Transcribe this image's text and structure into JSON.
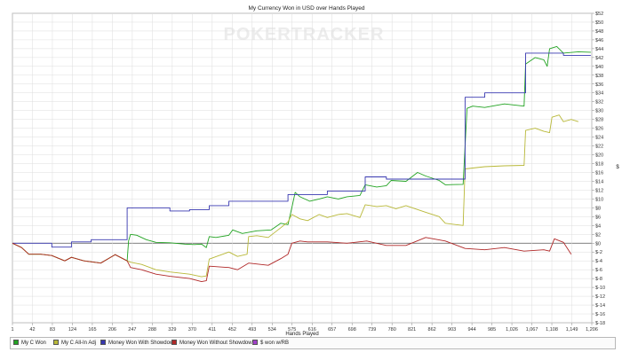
{
  "chart_data": {
    "type": "line",
    "title": "My Currency Won in USD over Hands Played",
    "watermark": "POKERTRACKER",
    "xlabel": "Hands Played",
    "ylabel": "$",
    "xlim": [
      1,
      1208
    ],
    "ylim": [
      -18,
      52
    ],
    "x_tick_labels": [
      "1",
      "42",
      "83",
      "124",
      "165",
      "206",
      "247",
      "288",
      "329",
      "370",
      "411",
      "452",
      "493",
      "534",
      "575",
      "616",
      "657",
      "698",
      "739",
      "780",
      "821",
      "862",
      "903",
      "944",
      "985",
      "1,026",
      "1,067",
      "1,108",
      "1,149",
      "1,206"
    ],
    "y_ticks": [
      -18,
      -16,
      -14,
      -12,
      -10,
      -8,
      -6,
      -4,
      -2,
      0,
      2,
      4,
      6,
      8,
      10,
      12,
      14,
      16,
      18,
      20,
      22,
      24,
      26,
      28,
      30,
      32,
      34,
      36,
      38,
      40,
      42,
      44,
      46,
      48,
      50,
      52
    ],
    "grid": true,
    "legend_position": "bottom",
    "series": [
      {
        "name": "My C Won",
        "color": "#22a322",
        "points": [
          [
            1,
            0
          ],
          [
            20,
            -1
          ],
          [
            35,
            -2.5
          ],
          [
            60,
            -2.5
          ],
          [
            83,
            -2.8
          ],
          [
            110,
            -4
          ],
          [
            124,
            -3.2
          ],
          [
            150,
            -4
          ],
          [
            185,
            -4.5
          ],
          [
            215,
            -2.6
          ],
          [
            240,
            -4
          ],
          [
            243,
            0.5
          ],
          [
            247,
            2
          ],
          [
            260,
            1.8
          ],
          [
            280,
            0.8
          ],
          [
            300,
            0.2
          ],
          [
            329,
            0.1
          ],
          [
            360,
            -0.2
          ],
          [
            380,
            -0.3
          ],
          [
            395,
            -0.2
          ],
          [
            405,
            -1
          ],
          [
            411,
            1.5
          ],
          [
            425,
            1.3
          ],
          [
            452,
            1.8
          ],
          [
            460,
            3
          ],
          [
            480,
            2.2
          ],
          [
            510,
            2.8
          ],
          [
            540,
            3
          ],
          [
            560,
            4.5
          ],
          [
            575,
            4.2
          ],
          [
            583,
            8
          ],
          [
            590,
            11.5
          ],
          [
            600,
            10.5
          ],
          [
            620,
            9.5
          ],
          [
            640,
            10
          ],
          [
            657,
            10.5
          ],
          [
            680,
            10
          ],
          [
            698,
            10.5
          ],
          [
            725,
            10.8
          ],
          [
            736,
            13.2
          ],
          [
            760,
            12.7
          ],
          [
            780,
            13
          ],
          [
            790,
            14.2
          ],
          [
            821,
            14
          ],
          [
            845,
            16
          ],
          [
            862,
            15.2
          ],
          [
            890,
            14.2
          ],
          [
            903,
            13.2
          ],
          [
            940,
            13.3
          ],
          [
            944,
            22
          ],
          [
            948,
            30.5
          ],
          [
            960,
            31
          ],
          [
            985,
            30.7
          ],
          [
            1026,
            31.5
          ],
          [
            1067,
            31
          ],
          [
            1070,
            40.5
          ],
          [
            1090,
            42
          ],
          [
            1108,
            41.5
          ],
          [
            1115,
            40
          ],
          [
            1120,
            44
          ],
          [
            1135,
            44.5
          ],
          [
            1149,
            43
          ],
          [
            1180,
            43.3
          ],
          [
            1206,
            43.2
          ]
        ]
      },
      {
        "name": "My C All-In Adj",
        "color": "#b8b838",
        "points": [
          [
            1,
            0
          ],
          [
            20,
            -1
          ],
          [
            35,
            -2.5
          ],
          [
            60,
            -2.5
          ],
          [
            83,
            -2.8
          ],
          [
            110,
            -4
          ],
          [
            124,
            -3.2
          ],
          [
            150,
            -4
          ],
          [
            185,
            -4.5
          ],
          [
            215,
            -2.6
          ],
          [
            240,
            -4
          ],
          [
            247,
            -4.3
          ],
          [
            270,
            -4.8
          ],
          [
            300,
            -6
          ],
          [
            329,
            -6.5
          ],
          [
            370,
            -7
          ],
          [
            395,
            -7.6
          ],
          [
            405,
            -7.4
          ],
          [
            411,
            -3.6
          ],
          [
            452,
            -2
          ],
          [
            470,
            -3
          ],
          [
            490,
            -2.5
          ],
          [
            493,
            1.5
          ],
          [
            510,
            1.7
          ],
          [
            534,
            1.3
          ],
          [
            560,
            3.5
          ],
          [
            575,
            4.8
          ],
          [
            583,
            6.5
          ],
          [
            600,
            5.5
          ],
          [
            616,
            5.1
          ],
          [
            640,
            6.5
          ],
          [
            657,
            5.8
          ],
          [
            680,
            6.5
          ],
          [
            698,
            6.7
          ],
          [
            725,
            5.8
          ],
          [
            736,
            8.7
          ],
          [
            760,
            8.3
          ],
          [
            780,
            8.5
          ],
          [
            800,
            7.8
          ],
          [
            821,
            8.5
          ],
          [
            862,
            7
          ],
          [
            890,
            6
          ],
          [
            903,
            4.5
          ],
          [
            940,
            4
          ],
          [
            944,
            16.8
          ],
          [
            960,
            17
          ],
          [
            985,
            17.3
          ],
          [
            1026,
            17.5
          ],
          [
            1067,
            17.6
          ],
          [
            1070,
            25.5
          ],
          [
            1090,
            26
          ],
          [
            1108,
            25.3
          ],
          [
            1120,
            25
          ],
          [
            1125,
            28.5
          ],
          [
            1140,
            29
          ],
          [
            1149,
            27.5
          ],
          [
            1165,
            28
          ],
          [
            1180,
            27.5
          ]
        ]
      },
      {
        "name": "Money Won With Showdown",
        "color": "#3838b0",
        "points": [
          [
            1,
            0
          ],
          [
            83,
            0
          ],
          [
            83,
            -0.9
          ],
          [
            124,
            -0.9
          ],
          [
            124,
            0.3
          ],
          [
            165,
            0.3
          ],
          [
            165,
            0.8
          ],
          [
            240,
            0.8
          ],
          [
            240,
            8
          ],
          [
            329,
            8
          ],
          [
            329,
            7.3
          ],
          [
            370,
            7.3
          ],
          [
            370,
            7.6
          ],
          [
            411,
            7.6
          ],
          [
            411,
            8.5
          ],
          [
            452,
            8.5
          ],
          [
            452,
            9.5
          ],
          [
            575,
            9.5
          ],
          [
            575,
            11
          ],
          [
            657,
            11
          ],
          [
            657,
            11.8
          ],
          [
            736,
            11.8
          ],
          [
            736,
            15
          ],
          [
            780,
            15
          ],
          [
            780,
            14.5
          ],
          [
            944,
            14.5
          ],
          [
            944,
            33
          ],
          [
            985,
            33
          ],
          [
            985,
            34
          ],
          [
            1070,
            34
          ],
          [
            1070,
            43
          ],
          [
            1149,
            43
          ],
          [
            1149,
            42.5
          ],
          [
            1206,
            42.5
          ]
        ]
      },
      {
        "name": "Money Won Without Showdown",
        "color": "#b02828",
        "points": [
          [
            1,
            0
          ],
          [
            20,
            -1
          ],
          [
            35,
            -2.5
          ],
          [
            60,
            -2.5
          ],
          [
            83,
            -2.8
          ],
          [
            110,
            -4
          ],
          [
            124,
            -3.2
          ],
          [
            150,
            -4
          ],
          [
            185,
            -4.5
          ],
          [
            215,
            -2.6
          ],
          [
            240,
            -4
          ],
          [
            247,
            -5.5
          ],
          [
            270,
            -6
          ],
          [
            300,
            -7
          ],
          [
            329,
            -7.5
          ],
          [
            370,
            -8
          ],
          [
            395,
            -8.7
          ],
          [
            405,
            -8.5
          ],
          [
            411,
            -5.2
          ],
          [
            452,
            -5.5
          ],
          [
            470,
            -6
          ],
          [
            493,
            -4.5
          ],
          [
            534,
            -5
          ],
          [
            560,
            -3.5
          ],
          [
            575,
            -2.5
          ],
          [
            583,
            0
          ],
          [
            600,
            0.5
          ],
          [
            616,
            0.3
          ],
          [
            657,
            0.3
          ],
          [
            698,
            0
          ],
          [
            739,
            0.5
          ],
          [
            780,
            -0.5
          ],
          [
            821,
            -0.5
          ],
          [
            862,
            1.3
          ],
          [
            903,
            0.5
          ],
          [
            944,
            -1.2
          ],
          [
            985,
            -1.5
          ],
          [
            1026,
            -1
          ],
          [
            1067,
            -1.8
          ],
          [
            1108,
            -1.5
          ],
          [
            1120,
            -1.8
          ],
          [
            1130,
            1
          ],
          [
            1149,
            0.2
          ],
          [
            1165,
            -2.5
          ]
        ]
      },
      {
        "name": "$ won w/RB",
        "color": "#a040c8",
        "points": []
      }
    ]
  }
}
